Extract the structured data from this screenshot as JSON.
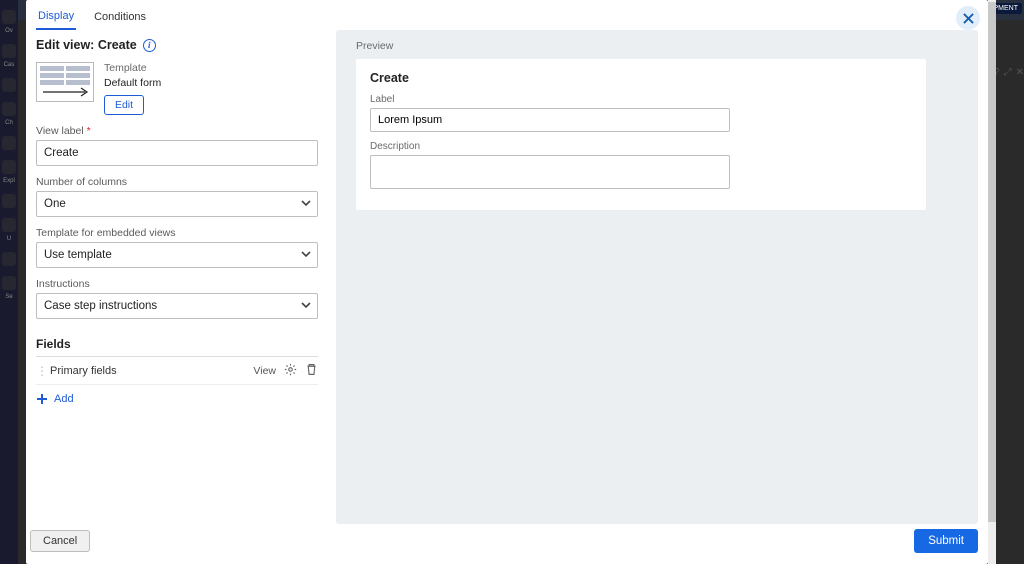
{
  "bg": {
    "badge": "PMENT",
    "rail_items": [
      "Ov",
      "Cas",
      "",
      "Ch",
      "",
      "Expl",
      "",
      "U",
      "",
      "Se"
    ]
  },
  "tabs": {
    "display": "Display",
    "conditions": "Conditions"
  },
  "close_aria": "Close",
  "left": {
    "title": "Edit view: Create",
    "template_label": "Template",
    "template_value": "Default form",
    "edit_btn": "Edit",
    "view_label": "View label",
    "view_label_value": "Create",
    "num_cols_label": "Number of columns",
    "num_cols_value": "One",
    "embedded_label": "Template for embedded views",
    "embedded_value": "Use template",
    "instructions_label": "Instructions",
    "instructions_value": "Case step instructions",
    "fields_heading": "Fields",
    "field_row": {
      "name": "Primary fields",
      "view": "View"
    },
    "add": "Add"
  },
  "preview": {
    "label": "Preview",
    "heading": "Create",
    "field_label": "Label",
    "field_value": "Lorem Ipsum",
    "desc_label": "Description",
    "desc_value": ""
  },
  "footer": {
    "cancel": "Cancel",
    "submit": "Submit"
  }
}
